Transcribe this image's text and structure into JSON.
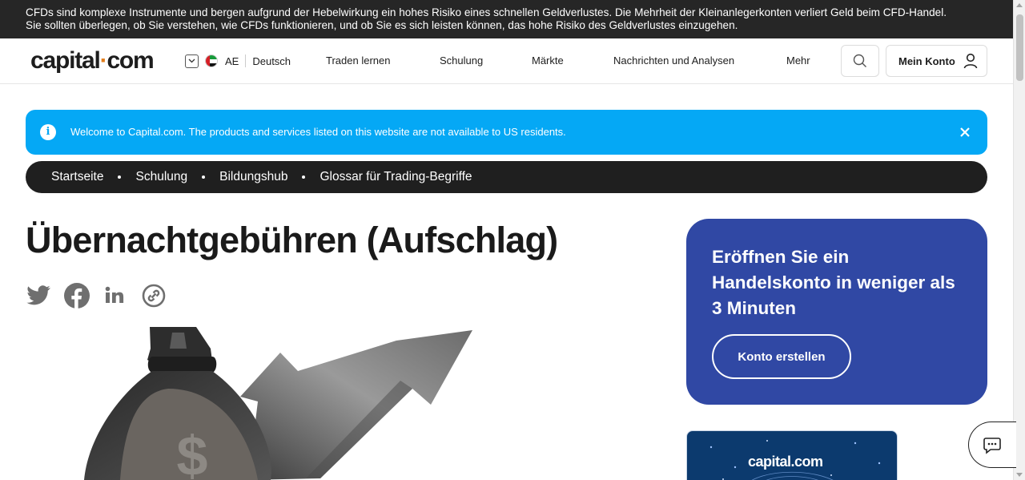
{
  "risk_banner": {
    "line1": "CFDs sind komplexe Instrumente und bergen aufgrund der Hebelwirkung ein hohes Risiko eines schnellen Geldverlustes. Die Mehrheit der Kleinanlegerkonten verliert Geld beim CFD-Handel.",
    "line2": "Sie sollten überlegen, ob Sie verstehen, wie CFDs funktionieren, und ob Sie es sich leisten können, das hohe Risiko des Geldverlustes einzugehen."
  },
  "header": {
    "logo_left": "capital",
    "logo_dot": "·",
    "logo_right": "com",
    "region_code": "AE",
    "language": "Deutsch",
    "nav": [
      "Traden lernen",
      "Schulung",
      "Märkte",
      "Nachrichten und Analysen",
      "Mehr"
    ],
    "account_label": "Mein Konto"
  },
  "notice": {
    "info_glyph": "i",
    "text": "Welcome to Capital.com. The products and services listed on this website are not available to US residents."
  },
  "breadcrumb": [
    "Startseite",
    "Schulung",
    "Bildungshub",
    "Glossar für Trading-Begriffe"
  ],
  "article": {
    "title": "Übernachtgebühren (Aufschlag)"
  },
  "share_icons": [
    "twitter-icon",
    "facebook-icon",
    "linkedin-icon",
    "copy-link-icon"
  ],
  "hero": {
    "currency_symbol": "$"
  },
  "cta": {
    "heading": "Eröffnen Sie ein Handelskonto in weniger als 3 Minuten",
    "button_label": "Konto erstellen"
  },
  "promo": {
    "logo_text": "capital.com"
  },
  "colors": {
    "risk_bg": "#262626",
    "notice_bg": "#05a8f5",
    "breadcrumb_bg": "#1f1f1f",
    "cta_bg": "#3048a4",
    "logo_dot": "#e27d1a"
  }
}
